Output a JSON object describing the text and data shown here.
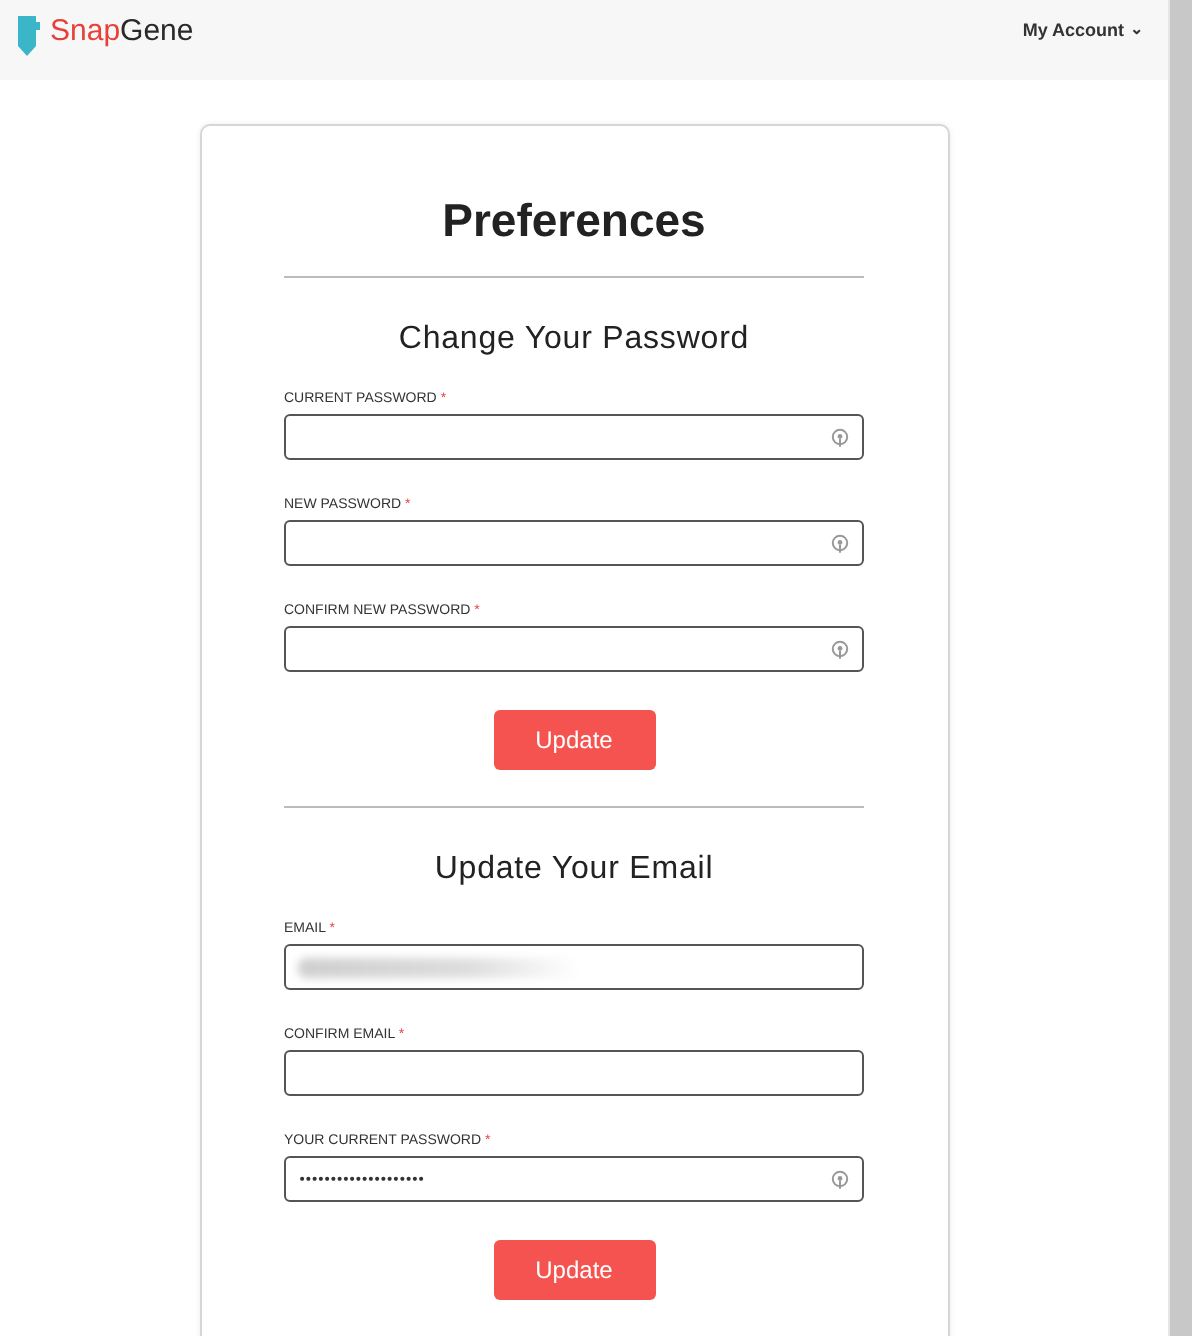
{
  "header": {
    "logo": {
      "first": "Snap",
      "second": "Gene"
    },
    "account_menu": {
      "label": "My Account",
      "caret": "⌄"
    }
  },
  "page": {
    "title": "Preferences",
    "sections": [
      {
        "title": "Change Your Password",
        "fields": [
          {
            "label": "CURRENT PASSWORD",
            "required_mark": "*",
            "kind": "password",
            "reveal_icon": true
          },
          {
            "label": "NEW PASSWORD",
            "required_mark": "*",
            "kind": "password",
            "reveal_icon": true
          },
          {
            "label": "CONFIRM NEW PASSWORD",
            "required_mark": "*",
            "kind": "password",
            "reveal_icon": true
          }
        ],
        "button": "Update"
      },
      {
        "title": "Update Your Email",
        "fields": [
          {
            "label": "EMAIL",
            "required_mark": "*",
            "kind": "redacted",
            "reveal_icon": false
          },
          {
            "label": "CONFIRM EMAIL",
            "required_mark": "*",
            "kind": "text",
            "reveal_icon": false
          },
          {
            "label": "YOUR CURRENT PASSWORD",
            "required_mark": "*",
            "kind": "password",
            "value": "••••••••••••••••••••",
            "reveal_icon": true
          }
        ],
        "button": "Update"
      }
    ]
  }
}
